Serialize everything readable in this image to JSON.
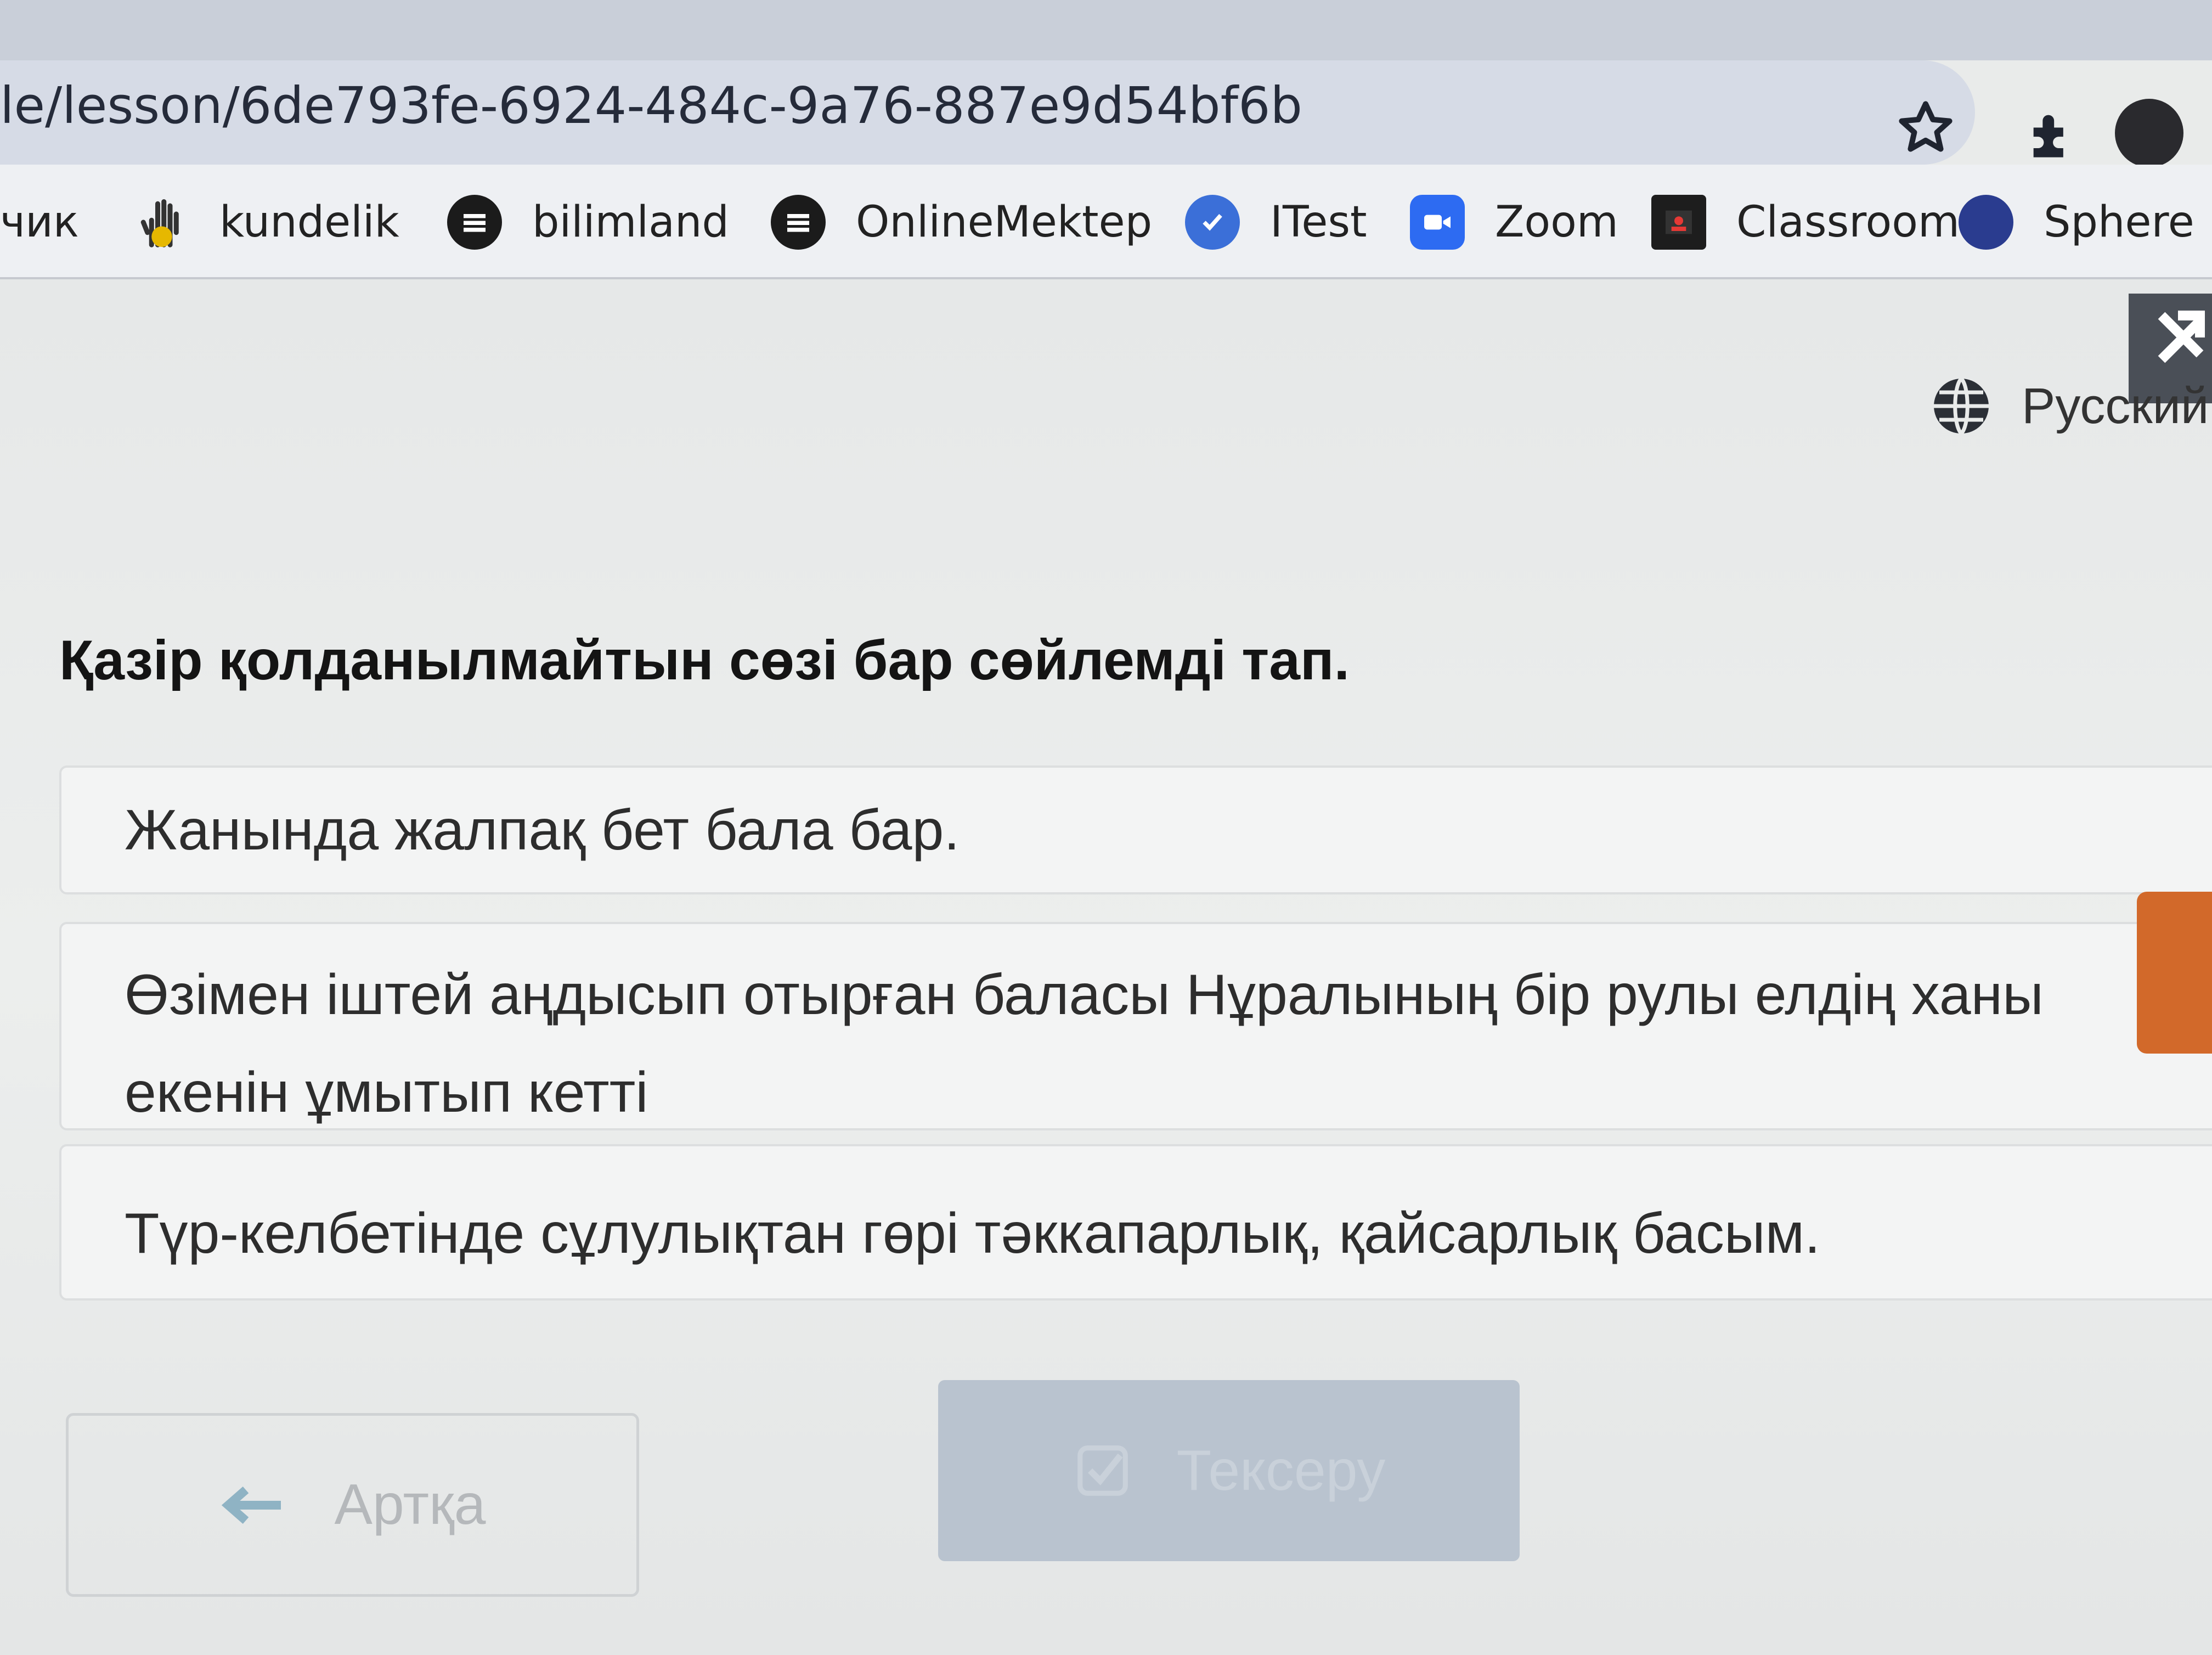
{
  "browser": {
    "url": "le/lesson/6de793fe-6924-484c-9a76-887e9d54bf6b",
    "icons": [
      "star-icon",
      "extensions-icon",
      "profile-icon"
    ]
  },
  "bookmarks": [
    {
      "label": "чик",
      "icon": "none"
    },
    {
      "label": "kundelik",
      "icon": "hand-icon"
    },
    {
      "label": "bilimland",
      "icon": "bilimland-icon"
    },
    {
      "label": "OnlineMektep",
      "icon": "onlinemektep-icon"
    },
    {
      "label": "ITest",
      "icon": "itest-icon"
    },
    {
      "label": "Zoom",
      "icon": "zoom-icon"
    },
    {
      "label": "Classroom",
      "icon": "classroom-icon"
    },
    {
      "label": "Sphere",
      "icon": "sphere-icon"
    }
  ],
  "header": {
    "language_label": "Русский"
  },
  "question": {
    "text": "Қазір қолданылмайтын сөзі бар сөйлемді тап.",
    "options": [
      "Жанында жалпақ бет бала бар.",
      "Өзімен іштей аңдысып отырған баласы Нұралының бір рулы елдің ханы екенін ұмытып кетті",
      "Түр-келбетінде сұлулықтан гөрі тәккапарлық, қайсарлық басым."
    ]
  },
  "footer": {
    "back_label": "Артқа",
    "check_label": "Тексеру"
  },
  "colors": {
    "accent_tab": "#d2692a",
    "check_button": "#b9c3cf"
  }
}
